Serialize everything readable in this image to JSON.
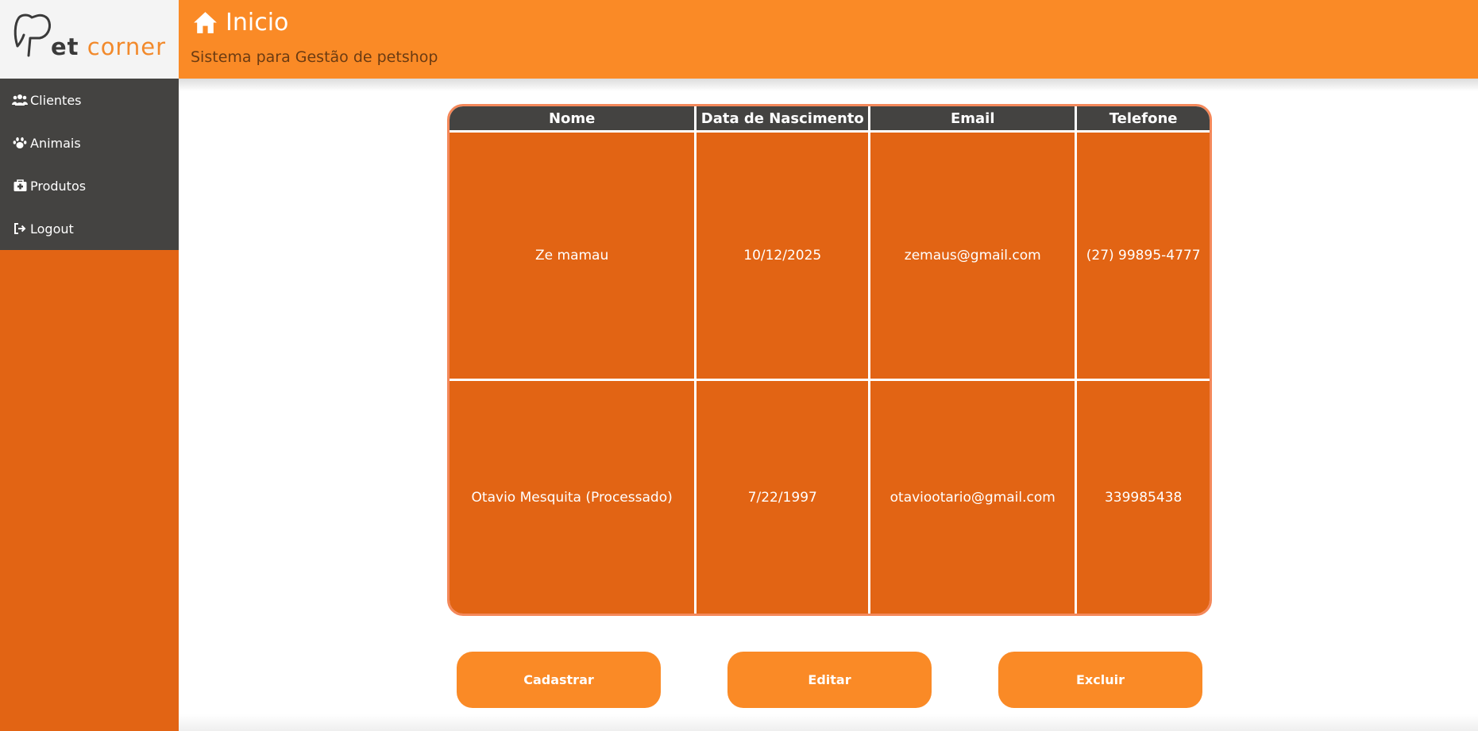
{
  "logo": {
    "part1": "et",
    "part2": "corner"
  },
  "sidebar": {
    "items": [
      {
        "label": "Clientes",
        "icon": "users-icon"
      },
      {
        "label": "Animais",
        "icon": "paw-icon"
      },
      {
        "label": "Produtos",
        "icon": "medkit-icon"
      },
      {
        "label": "Logout",
        "icon": "logout-icon"
      }
    ]
  },
  "header": {
    "title": "Inicio",
    "subtitle": "Sistema para Gestão de petshop",
    "icon": "home-icon"
  },
  "table": {
    "columns": [
      "Nome",
      "Data de Nascimento",
      "Email",
      "Telefone"
    ],
    "rows": [
      [
        "Ze mamau",
        "10/12/2025",
        "zemaus@gmail.com",
        "(27) 99895-4777"
      ],
      [
        "Otavio Mesquita (Processado)",
        "7/22/1997",
        "otaviootario@gmail.com",
        "339985438"
      ]
    ]
  },
  "actions": {
    "create": "Cadastrar",
    "edit": "Editar",
    "delete": "Excluir"
  },
  "colors": {
    "accent": "#fa8a26",
    "dark": "#444341",
    "cell": "#e26414"
  }
}
